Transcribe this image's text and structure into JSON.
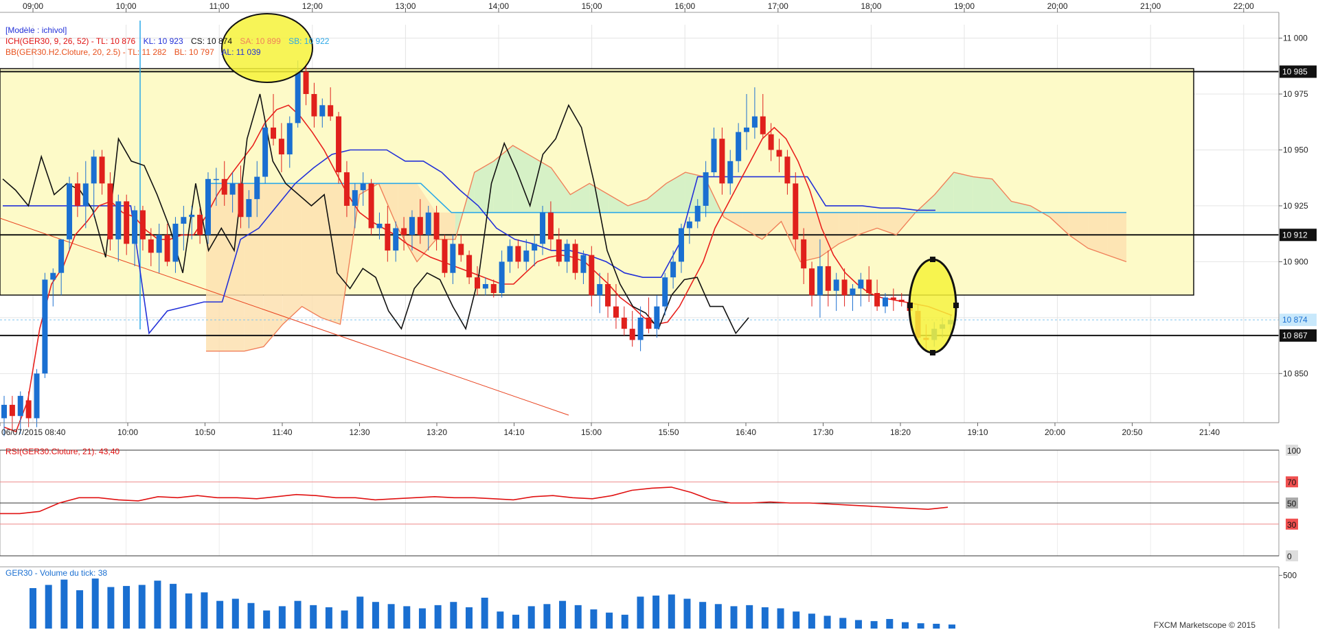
{
  "colors": {
    "bull": "#1a6fd1",
    "bear": "#e0201c",
    "tenkan": "#e8201c",
    "kijun": "#2230d8",
    "chikou": "#111111",
    "senkou_a": "#f0805a",
    "senkou_b": "#2aa8e8",
    "cloud_up": "#cfeec6",
    "cloud_down": "#fde0b0",
    "zone": "#fdfac8",
    "highlight": "#f6f23a",
    "rsi": "#e01010",
    "volume": "#1a6fd1"
  },
  "top_axis": [
    "09:00",
    "10:00",
    "11:00",
    "12:00",
    "13:00",
    "14:00",
    "15:00",
    "16:00",
    "17:00",
    "18:00",
    "19:00",
    "20:00",
    "21:00",
    "22:00"
  ],
  "price_panel": {
    "model_label": "[Modèle : ichivol]",
    "ich_line": {
      "prefix": "ICH(GER30, 9, 26, 52) - ",
      "tl": "TL: 10 876",
      "kl": "KL: 10 923",
      "cs": "CS: 10 874",
      "sa": "SA: 10 899",
      "sb": "SB: 10 922"
    },
    "bb_line": {
      "prefix": "BB(GER30.H2.Cloture, 20, 2.5) - ",
      "tl": "TL: 11 282",
      "bl": "BL: 10 797",
      "al": "AL: 11 039"
    },
    "y_ticks": [
      "11 000",
      "10 975",
      "10 950",
      "10 925",
      "10 900",
      "10 850"
    ],
    "level_tags": [
      "10 985",
      "10 912",
      "10 874",
      "10 867"
    ]
  },
  "bottom_axis": [
    "06/07/2015 08:40",
    "10:00",
    "10:50",
    "11:40",
    "12:30",
    "13:20",
    "14:10",
    "15:00",
    "15:50",
    "16:40",
    "17:30",
    "18:20",
    "19:10",
    "20:00",
    "20:50",
    "21:40"
  ],
  "rsi_panel": {
    "label": "RSI(GER30.Cloture, 21): 43,40",
    "ticks": [
      "100",
      "70",
      "50",
      "30",
      "0"
    ]
  },
  "volume_panel": {
    "label": "GER30 - Volume du tick: 38",
    "ticks": [
      "500"
    ]
  },
  "footer": "FXCM Marketscope © 2015",
  "chart_data": {
    "type": "candlestick",
    "instrument": "GER30",
    "ylim": [
      10828,
      11006
    ],
    "levels": [
      10985,
      10912,
      10874,
      10867
    ],
    "candles_ohlc": [
      [
        10830,
        10840,
        10822,
        10836
      ],
      [
        10836,
        10840,
        10825,
        10831
      ],
      [
        10831,
        10842,
        10823,
        10840
      ],
      [
        10838,
        10842,
        10826,
        10830
      ],
      [
        10830,
        10852,
        10826,
        10850
      ],
      [
        10850,
        10895,
        10848,
        10892
      ],
      [
        10892,
        10897,
        10880,
        10895
      ],
      [
        10895,
        10910,
        10885,
        10910
      ],
      [
        10910,
        10938,
        10905,
        10935
      ],
      [
        10935,
        10940,
        10920,
        10925
      ],
      [
        10925,
        10945,
        10915,
        10935
      ],
      [
        10935,
        10950,
        10920,
        10947
      ],
      [
        10947,
        10950,
        10930,
        10935
      ],
      [
        10935,
        10940,
        10905,
        10910
      ],
      [
        10910,
        10930,
        10900,
        10927
      ],
      [
        10927,
        10930,
        10903,
        10908
      ],
      [
        10908,
        10925,
        10898,
        10923
      ],
      [
        10923,
        10925,
        10905,
        10910
      ],
      [
        10910,
        10915,
        10898,
        10904
      ],
      [
        10904,
        10917,
        10895,
        10912
      ],
      [
        10912,
        10917,
        10898,
        10900
      ],
      [
        10900,
        10920,
        10895,
        10917
      ],
      [
        10917,
        10925,
        10905,
        10920
      ],
      [
        10920,
        10925,
        10910,
        10921
      ],
      [
        10921,
        10924,
        10908,
        10912
      ],
      [
        10912,
        10940,
        10908,
        10937
      ],
      [
        10937,
        10942,
        10925,
        10937
      ],
      [
        10937,
        10945,
        10925,
        10930
      ],
      [
        10930,
        10940,
        10922,
        10935
      ],
      [
        10935,
        10943,
        10915,
        10920
      ],
      [
        10920,
        10932,
        10915,
        10928
      ],
      [
        10928,
        10945,
        10920,
        10938
      ],
      [
        10938,
        10962,
        10935,
        10960
      ],
      [
        10960,
        10975,
        10952,
        10955
      ],
      [
        10955,
        10962,
        10940,
        10948
      ],
      [
        10948,
        10965,
        10942,
        10962
      ],
      [
        10962,
        10990,
        10960,
        10985
      ],
      [
        10985,
        10990,
        10970,
        10975
      ],
      [
        10975,
        10980,
        10960,
        10965
      ],
      [
        10965,
        10973,
        10960,
        10970
      ],
      [
        10970,
        10978,
        10963,
        10965
      ],
      [
        10965,
        10967,
        10935,
        10940
      ],
      [
        10940,
        10945,
        10920,
        10925
      ],
      [
        10925,
        10935,
        10915,
        10932
      ],
      [
        10932,
        10940,
        10925,
        10935
      ],
      [
        10935,
        10937,
        10912,
        10915
      ],
      [
        10915,
        10922,
        10910,
        10917
      ],
      [
        10917,
        10925,
        10900,
        10905
      ],
      [
        10905,
        10918,
        10900,
        10915
      ],
      [
        10915,
        10920,
        10905,
        10912
      ],
      [
        10912,
        10923,
        10905,
        10920
      ],
      [
        10920,
        10928,
        10908,
        10912
      ],
      [
        10912,
        10925,
        10905,
        10922
      ],
      [
        10922,
        10925,
        10905,
        10910
      ],
      [
        10910,
        10912,
        10893,
        10895
      ],
      [
        10895,
        10912,
        10890,
        10908
      ],
      [
        10908,
        10912,
        10900,
        10903
      ],
      [
        10903,
        10905,
        10890,
        10893
      ],
      [
        10893,
        10898,
        10885,
        10888
      ],
      [
        10888,
        10893,
        10885,
        10890
      ],
      [
        10890,
        10892,
        10884,
        10886
      ],
      [
        10886,
        10905,
        10884,
        10900
      ],
      [
        10900,
        10910,
        10895,
        10907
      ],
      [
        10907,
        10910,
        10897,
        10900
      ],
      [
        10900,
        10910,
        10896,
        10905
      ],
      [
        10905,
        10912,
        10898,
        10908
      ],
      [
        10908,
        10925,
        10903,
        10922
      ],
      [
        10922,
        10927,
        10905,
        10910
      ],
      [
        10910,
        10915,
        10898,
        10900
      ],
      [
        10900,
        10910,
        10895,
        10908
      ],
      [
        10908,
        10910,
        10892,
        10895
      ],
      [
        10895,
        10905,
        10890,
        10903
      ],
      [
        10903,
        10907,
        10880,
        10885
      ],
      [
        10885,
        10895,
        10877,
        10890
      ],
      [
        10890,
        10895,
        10875,
        10880
      ],
      [
        10880,
        10890,
        10870,
        10875
      ],
      [
        10875,
        10880,
        10867,
        10870
      ],
      [
        10870,
        10878,
        10862,
        10865
      ],
      [
        10865,
        10880,
        10860,
        10875
      ],
      [
        10875,
        10884,
        10868,
        10870
      ],
      [
        10870,
        10885,
        10866,
        10880
      ],
      [
        10880,
        10895,
        10876,
        10893
      ],
      [
        10893,
        10905,
        10888,
        10900
      ],
      [
        10900,
        10917,
        10895,
        10915
      ],
      [
        10915,
        10920,
        10908,
        10918
      ],
      [
        10918,
        10928,
        10915,
        10925
      ],
      [
        10925,
        10945,
        10920,
        10940
      ],
      [
        10940,
        10960,
        10938,
        10955
      ],
      [
        10955,
        10960,
        10930,
        10935
      ],
      [
        10935,
        10950,
        10930,
        10945
      ],
      [
        10945,
        10962,
        10940,
        10958
      ],
      [
        10958,
        10975,
        10950,
        10960
      ],
      [
        10960,
        10978,
        10955,
        10965
      ],
      [
        10965,
        10975,
        10955,
        10957
      ],
      [
        10957,
        10962,
        10945,
        10950
      ],
      [
        10950,
        10955,
        10940,
        10947
      ],
      [
        10947,
        10950,
        10930,
        10935
      ],
      [
        10935,
        10940,
        10905,
        10910
      ],
      [
        10910,
        10915,
        10890,
        10897
      ],
      [
        10897,
        10900,
        10880,
        10885
      ],
      [
        10885,
        10910,
        10875,
        10898
      ],
      [
        10898,
        10905,
        10880,
        10887
      ],
      [
        10887,
        10895,
        10878,
        10892
      ],
      [
        10892,
        10897,
        10880,
        10885
      ],
      [
        10885,
        10890,
        10878,
        10888
      ],
      [
        10888,
        10895,
        10880,
        10892
      ],
      [
        10892,
        10898,
        10882,
        10886
      ],
      [
        10886,
        10892,
        10878,
        10880
      ],
      [
        10880,
        10886,
        10877,
        10884
      ],
      [
        10884,
        10888,
        10878,
        10883
      ],
      [
        10883,
        10886,
        10880,
        10882
      ],
      [
        10882,
        10886,
        10876,
        10878
      ],
      [
        10878,
        10881,
        10863,
        10866
      ],
      [
        10866,
        10872,
        10860,
        10865
      ],
      [
        10865,
        10873,
        10862,
        10870
      ],
      [
        10870,
        10875,
        10866,
        10872
      ],
      [
        10872,
        10876,
        10868,
        10874
      ]
    ],
    "tenkan": [
      10826,
      10824,
      10838,
      10870,
      10890,
      10898,
      10912,
      10918,
      10925,
      10927,
      10922,
      10920,
      10914,
      10910,
      10910,
      10912,
      10912,
      10920,
      10930,
      10938,
      10945,
      10952,
      10962,
      10968,
      10970,
      10965,
      10958,
      10950,
      10940,
      10930,
      10922,
      10918,
      10915,
      10912,
      10908,
      10905,
      10902,
      10900,
      10898,
      10896,
      10894,
      10892,
      10890,
      10890,
      10895,
      10900,
      10902,
      10903,
      10902,
      10900,
      10895,
      10890,
      10884,
      10880,
      10875,
      10872,
      10873,
      10880,
      10890,
      10900,
      10915,
      10925,
      10935,
      10945,
      10955,
      10960,
      10955,
      10945,
      10932,
      10915,
      10903,
      10895,
      10890,
      10886,
      10884,
      10883,
      10882,
      10881,
      10880,
      10878,
      10876
    ],
    "kijun": [
      10925,
      10925,
      10925,
      10925,
      10925,
      10925,
      10925,
      10925,
      10868,
      10878,
      10880,
      10882,
      10882,
      10910,
      10915,
      10925,
      10935,
      10942,
      10948,
      10950,
      10950,
      10950,
      10945,
      10945,
      10940,
      10932,
      10925,
      10915,
      10910,
      10908,
      10905,
      10905,
      10903,
      10900,
      10895,
      10893,
      10893,
      10908,
      10938,
      10938,
      10938,
      10938,
      10938,
      10938,
      10938,
      10925,
      10925,
      10925,
      10924,
      10924,
      10923,
      10923
    ],
    "chikou": [
      10937,
      10932,
      10925,
      10947,
      10930,
      10935,
      10932,
      10923,
      10902,
      10955,
      10945,
      10943,
      10930,
      10915,
      10895,
      10935,
      10905,
      10915,
      10905,
      10955,
      10975,
      10945,
      10935,
      10930,
      10925,
      10930,
      10895,
      10888,
      10897,
      10893,
      10878,
      10870,
      10888,
      10895,
      10892,
      10880,
      10870,
      10893,
      10935,
      10953,
      10940,
      10925,
      10948,
      10955,
      10970,
      10960,
      10935,
      10905,
      10890,
      10880,
      10877,
      10870,
      10885,
      10892,
      10893,
      10880,
      10880,
      10868,
      10875
    ],
    "senkou_a": [
      10860,
      10860,
      10860,
      10862,
      10872,
      10880,
      10875,
      10872,
      10930,
      10935,
      10915,
      10900,
      10910,
      10910,
      10940,
      10945,
      10952,
      10947,
      10942,
      10930,
      10935,
      10930,
      10925,
      10928,
      10935,
      10940,
      10938,
      10920,
      10915,
      10910,
      10918,
      10900,
      10902,
      10908,
      10912,
      10915,
      10912,
      10922,
      10930,
      10940,
      10938,
      10937,
      10927,
      10925,
      10920,
      10912,
      10906,
      10903,
      10900
    ],
    "senkou_b": [
      10935,
      10935,
      10935,
      10935,
      10935,
      10935,
      10935,
      10935,
      10922,
      10922,
      10922,
      10922,
      10922,
      10922,
      10922,
      10922,
      10922,
      10922,
      10922,
      10922,
      10922,
      10922,
      10922,
      10922,
      10922,
      10922,
      10922,
      10922,
      10922,
      10922,
      10922
    ],
    "rsi": [
      40,
      40,
      42,
      50,
      55,
      55,
      53,
      52,
      56,
      55,
      57,
      55,
      55,
      54,
      56,
      58,
      57,
      55,
      55,
      53,
      54,
      55,
      56,
      55,
      55,
      54,
      53,
      56,
      57,
      55,
      54,
      57,
      62,
      64,
      65,
      60,
      53,
      50,
      50,
      51,
      50,
      50,
      49,
      48,
      47,
      46,
      45,
      44,
      46
    ],
    "volume": [
      380,
      410,
      460,
      360,
      470,
      390,
      400,
      410,
      450,
      420,
      330,
      340,
      260,
      280,
      240,
      170,
      210,
      260,
      220,
      200,
      170,
      300,
      250,
      230,
      210,
      190,
      220,
      250,
      200,
      290,
      160,
      130,
      210,
      230,
      260,
      220,
      180,
      150,
      130,
      300,
      310,
      320,
      280,
      250,
      230,
      210,
      220,
      200,
      190,
      160,
      140,
      120,
      100,
      80,
      70,
      90,
      60,
      50,
      45,
      38
    ]
  }
}
